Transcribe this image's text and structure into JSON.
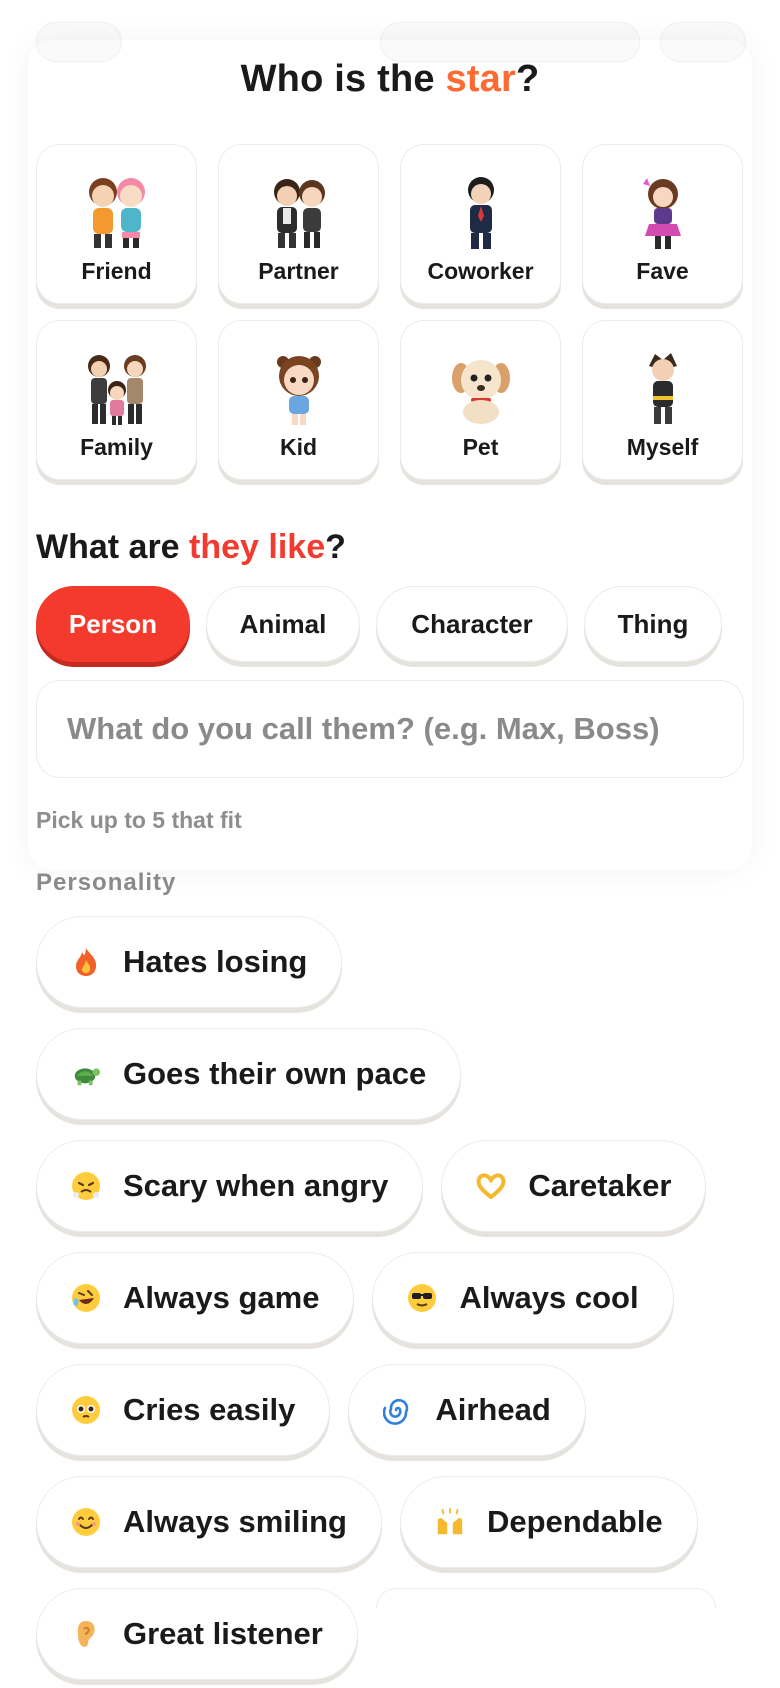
{
  "title": {
    "prefix": "Who is the ",
    "highlight": "star",
    "suffix": "?"
  },
  "star_options": [
    {
      "label": "Friend",
      "icon": "two-friends-avatar"
    },
    {
      "label": "Partner",
      "icon": "couple-avatar"
    },
    {
      "label": "Coworker",
      "icon": "suit-person-avatar"
    },
    {
      "label": "Fave",
      "icon": "idol-girl-avatar"
    },
    {
      "label": "Family",
      "icon": "family-avatar"
    },
    {
      "label": "Kid",
      "icon": "child-avatar"
    },
    {
      "label": "Pet",
      "icon": "puppy-avatar"
    },
    {
      "label": "Myself",
      "icon": "self-avatar"
    }
  ],
  "like_heading": {
    "prefix": "What are ",
    "highlight": "they like",
    "suffix": "?"
  },
  "types": [
    {
      "label": "Person",
      "active": true
    },
    {
      "label": "Animal",
      "active": false
    },
    {
      "label": "Character",
      "active": false
    },
    {
      "label": "Thing",
      "active": false
    }
  ],
  "name_input": {
    "placeholder": "What do you call them? (e.g. Max, Boss)",
    "value": ""
  },
  "pick_hint": "Pick up to 5 that fit",
  "category": "Personality",
  "traits": [
    {
      "label": "Hates losing",
      "icon": "fire-icon"
    },
    {
      "label": "Goes their own pace",
      "icon": "turtle-icon"
    },
    {
      "label": "Scary when angry",
      "icon": "steam-face-icon"
    },
    {
      "label": "Caretaker",
      "icon": "heart-hands-icon"
    },
    {
      "label": "Always game",
      "icon": "rofl-face-icon"
    },
    {
      "label": "Always cool",
      "icon": "sunglasses-face-icon"
    },
    {
      "label": "Cries easily",
      "icon": "pleading-face-icon"
    },
    {
      "label": "Airhead",
      "icon": "cyclone-icon"
    },
    {
      "label": "Always smiling",
      "icon": "smiling-face-icon"
    },
    {
      "label": "Dependable",
      "icon": "raised-hands-icon"
    },
    {
      "label": "Great listener",
      "icon": "ear-icon"
    }
  ],
  "colors": {
    "accent_orange": "#ff6a33",
    "accent_red": "#f23b2e",
    "active_pill": "#f43a2d"
  }
}
